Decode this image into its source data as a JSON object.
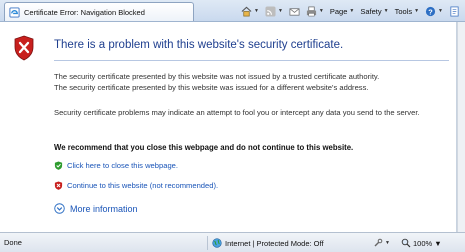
{
  "tab": {
    "title": "Certificate Error: Navigation Blocked"
  },
  "commands": {
    "page_label": "Page",
    "safety_label": "Safety",
    "tools_label": "Tools"
  },
  "page": {
    "headline": "There is a problem with this website's security certificate.",
    "para1_line1": "The security certificate presented by this website was not issued by a trusted certificate authority.",
    "para1_line2": "The security certificate presented by this website was issued for a different website's address.",
    "para2": "Security certificate problems may indicate an attempt to fool you or intercept any data you send to the server.",
    "recommend": "We recommend that you close this webpage and do not continue to this website.",
    "close_link": "Click here to close this webpage.",
    "continue_link": "Continue to this website (not recommended).",
    "more_info": "More information"
  },
  "status": {
    "text": "Done",
    "zone": "Internet | Protected Mode: Off",
    "zoom": "100%"
  },
  "icons": {
    "tab": "ie-page-icon",
    "home": "home-icon",
    "feeds": "feeds-icon",
    "mail": "mail-icon",
    "print": "print-icon",
    "help": "help-icon",
    "research": "research-icon",
    "shield": "error-shield-icon",
    "close_link": "green-shield-check-icon",
    "continue_link": "red-shield-x-icon",
    "more_info": "chevron-down-circle-icon",
    "zone": "globe-icon",
    "zoom": "magnifier-icon"
  },
  "colors": {
    "headline": "#1f3f8f",
    "link": "#1a55b8",
    "error_red": "#c8201e",
    "ok_green": "#2e9b2e"
  }
}
